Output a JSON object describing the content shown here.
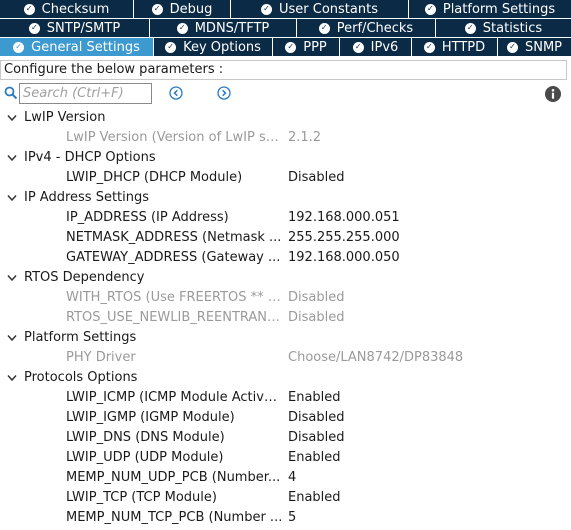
{
  "tabs": {
    "row1": [
      "Checksum",
      "Debug",
      "User Constants",
      "Platform Settings"
    ],
    "row2": [
      "SNTP/SMTP",
      "MDNS/TFTP",
      "Perf/Checks",
      "Statistics"
    ],
    "row3": [
      "General Settings",
      "Key Options",
      "PPP",
      "IPv6",
      "HTTPD",
      "SNMP"
    ],
    "active": "General Settings"
  },
  "configure_label": "Configure the below parameters :",
  "search": {
    "placeholder": "Search (Ctrl+F)",
    "value": ""
  },
  "icons": {
    "search": "magnifier-icon",
    "prev": "circle-chevron-left-icon",
    "next": "circle-chevron-right-icon",
    "info": "info-icon",
    "tab_check": "check-circle-icon",
    "group_toggle": "caret-down-icon"
  },
  "colors": {
    "tab_bg": "#0b2a45",
    "tab_active_bg": "#3c9ad0",
    "link_blue": "#2a7ac0",
    "disabled_text": "#9a9a9a"
  },
  "groups": [
    {
      "label": "LwIP Version",
      "params": [
        {
          "name": "LwIP Version (Version of LwIP su...",
          "value": "2.1.2",
          "disabled": true
        }
      ]
    },
    {
      "label": "IPv4 - DHCP Options",
      "params": [
        {
          "name": "LWIP_DHCP (DHCP Module)",
          "value": "Disabled",
          "disabled": false
        }
      ]
    },
    {
      "label": "IP Address Settings",
      "params": [
        {
          "name": "IP_ADDRESS (IP Address)",
          "value": "192.168.000.051",
          "disabled": false
        },
        {
          "name": "NETMASK_ADDRESS (Netmask ...",
          "value": "255.255.255.000",
          "disabled": false
        },
        {
          "name": "GATEWAY_ADDRESS (Gateway ...",
          "value": "192.168.000.050",
          "disabled": false
        }
      ]
    },
    {
      "label": "RTOS Dependency",
      "params": [
        {
          "name": "WITH_RTOS (Use FREERTOS ** C...",
          "value": "Disabled",
          "disabled": true
        },
        {
          "name": "RTOS_USE_NEWLIB_REENTRANT...",
          "value": "Disabled",
          "disabled": true
        }
      ]
    },
    {
      "label": "Platform Settings",
      "params": [
        {
          "name": "PHY Driver",
          "value": "Choose/LAN8742/DP83848",
          "disabled": true
        }
      ]
    },
    {
      "label": "Protocols Options",
      "params": [
        {
          "name": "LWIP_ICMP (ICMP Module Activat...",
          "value": "Enabled",
          "disabled": false
        },
        {
          "name": "LWIP_IGMP (IGMP Module)",
          "value": "Disabled",
          "disabled": false
        },
        {
          "name": "LWIP_DNS (DNS Module)",
          "value": "Disabled",
          "disabled": false
        },
        {
          "name": "LWIP_UDP (UDP Module)",
          "value": "Enabled",
          "disabled": false
        },
        {
          "name": "MEMP_NUM_UDP_PCB (Number...",
          "value": "4",
          "disabled": false
        },
        {
          "name": "LWIP_TCP (TCP Module)",
          "value": "Enabled",
          "disabled": false
        },
        {
          "name": "MEMP_NUM_TCP_PCB (Number ...",
          "value": "5",
          "disabled": false
        }
      ]
    }
  ]
}
